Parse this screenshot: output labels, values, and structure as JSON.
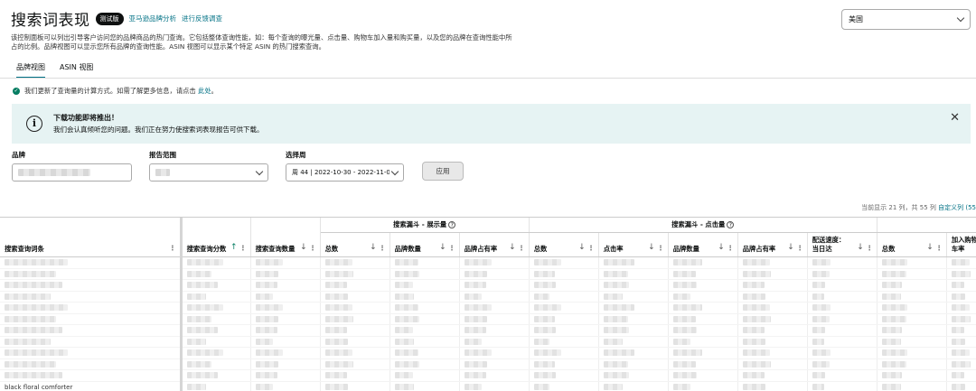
{
  "header": {
    "title": "搜索词表现",
    "badge": "测试版",
    "links": [
      "亚马逊品牌分析",
      "进行反馈调查"
    ],
    "description": "该控制面板可以列出引导客户访问您的品牌商品的热门查询。它包括整体查询性能，如：每个查询的曝光量、点击量、购物车加入量和购买量，以及您的品牌在查询性能中所占的比例。品牌视图可以显示您所有品牌的查询性能。ASIN 视图可以显示某个特定 ASIN 的热门搜索查询。"
  },
  "marketplace": {
    "value": "美国"
  },
  "tabs": [
    {
      "label": "品牌视图",
      "active": true
    },
    {
      "label": "ASIN 视图",
      "active": false
    }
  ],
  "notice": {
    "text": "我们更新了查询量的计算方式。如需了解更多信息，请点击",
    "link": "此处",
    "end": "。"
  },
  "banner": {
    "title": "下载功能即将推出！",
    "subtitle": "我们会认真倾听您的问题。我们正在努力使搜索词表现报告可供下载。"
  },
  "filters": {
    "brand_label": "品牌",
    "range_label": "报告范围",
    "period_label": "选择周",
    "period_value": "周 44 | 2022-10-30 - 2022-11-0",
    "apply_label": "应用"
  },
  "table_info": {
    "count_text": "当前显示 21 列，共 55 列",
    "customize_link": "自定义列 (55"
  },
  "table": {
    "groups": [
      "搜索漏斗 - 展示量",
      "搜索漏斗 - 点击量"
    ],
    "columns": {
      "query": "搜索查询词条",
      "score": "搜索查询分数",
      "volume": "搜索查询数量",
      "imp_total": "总数",
      "imp_brand": "品牌数量",
      "imp_share": "品牌占有率",
      "clk_total": "总数",
      "clk_rate": "点击率",
      "clk_brand": "品牌数量",
      "clk_share": "品牌占有率",
      "clk_ship": "配送速度：当日达",
      "cart_total": "总数",
      "cart_rate": "加入购物车率"
    },
    "last_visible_query": "black floral comforter"
  }
}
